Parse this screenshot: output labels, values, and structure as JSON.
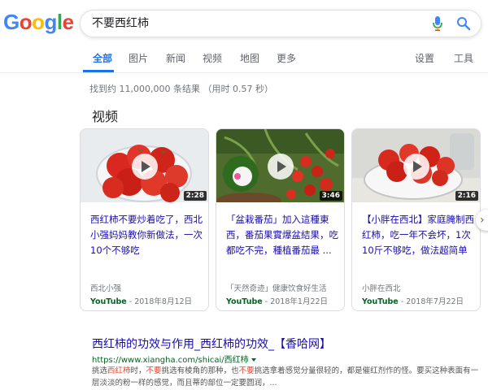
{
  "logo": {
    "letters": [
      "G",
      "o",
      "o",
      "g",
      "l",
      "e"
    ],
    "colors": [
      "#4285F4",
      "#EA4335",
      "#FBBC05",
      "#4285F4",
      "#34A853",
      "#EA4335"
    ]
  },
  "search": {
    "query": "不要西红柿"
  },
  "tabs": [
    {
      "label": "全部",
      "active": true
    },
    {
      "label": "图片"
    },
    {
      "label": "新闻"
    },
    {
      "label": "视频"
    },
    {
      "label": "地图"
    },
    {
      "label": "更多"
    }
  ],
  "tools": {
    "settings": "设置",
    "tools": "工具"
  },
  "stats": "找到约 11,000,000 条结果 （用时 0.57 秒）",
  "videos": {
    "title": "视频",
    "cards": [
      {
        "title": "西红柿不要炒着吃了，西北小强妈妈教你新做法，一次10个不够吃",
        "duration": "2:28",
        "source": "西北小强",
        "platform": "YouTube",
        "date": " - 2018年8月12日"
      },
      {
        "title": "「盆栽番茄」加入這種東西，番茄果實爆盆結果，吃都吃不完，種植番茄最 ...",
        "duration": "3:46",
        "source": "「天然奇迹」健康饮食好生活",
        "platform": "YouTube",
        "date": " - 2018年1月22日"
      },
      {
        "title": "【小胖在西北】家庭腌制西红柿，吃一年不会坏，1次10斤不够吃，做法超简单",
        "duration": "2:16",
        "source": "小胖在西北",
        "platform": "YouTube",
        "date": " - 2018年7月22日"
      }
    ]
  },
  "result": {
    "title": "西红柿的功效与作用_西红柿的功效_【香哈网】",
    "url": "https://www.xiangha.com/shicai/西红柿",
    "snippet": {
      "p1": "挑选",
      "h1": "西红柿",
      "p2": "时，",
      "h2": "不要",
      "p3": "挑选有棱角的那种，也",
      "h3": "不要",
      "p4": "挑选拿着感觉分量很轻的，都是催红剂作的怪。要买这种表面有一层淡淡的粉一样的感觉，而且蒂的部位一定要圆润，..."
    }
  }
}
